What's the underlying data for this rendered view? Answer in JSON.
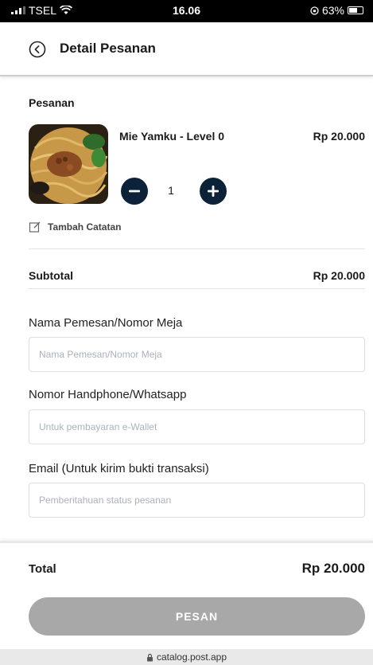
{
  "status_bar": {
    "carrier": "TSEL",
    "time": "16.06",
    "battery": "63%"
  },
  "header": {
    "title": "Detail Pesanan"
  },
  "order": {
    "section_title": "Pesanan",
    "item": {
      "name": "Mie Yamku - Level 0",
      "price": "Rp 20.000",
      "quantity": "1"
    },
    "note_label": "Tambah Catatan"
  },
  "subtotal": {
    "label": "Subtotal",
    "value": "Rp 20.000"
  },
  "form": {
    "name_label": "Nama Pemesan/Nomor Meja",
    "name_placeholder": "Nama Pemesan/Nomor Meja",
    "phone_label": "Nomor Handphone/Whatsapp",
    "phone_placeholder": "Untuk pembayaran e-Wallet",
    "email_label": "Email (Untuk kirim bukti transaksi)",
    "email_placeholder": "Pemberitahuan status pesanan"
  },
  "footer": {
    "total_label": "Total",
    "total_value": "Rp 20.000",
    "submit_label": "PESAN"
  },
  "browser": {
    "url": "catalog.post.app"
  },
  "colors": {
    "stepper": "#0b2239",
    "button_disabled": "#a8a8a8"
  }
}
